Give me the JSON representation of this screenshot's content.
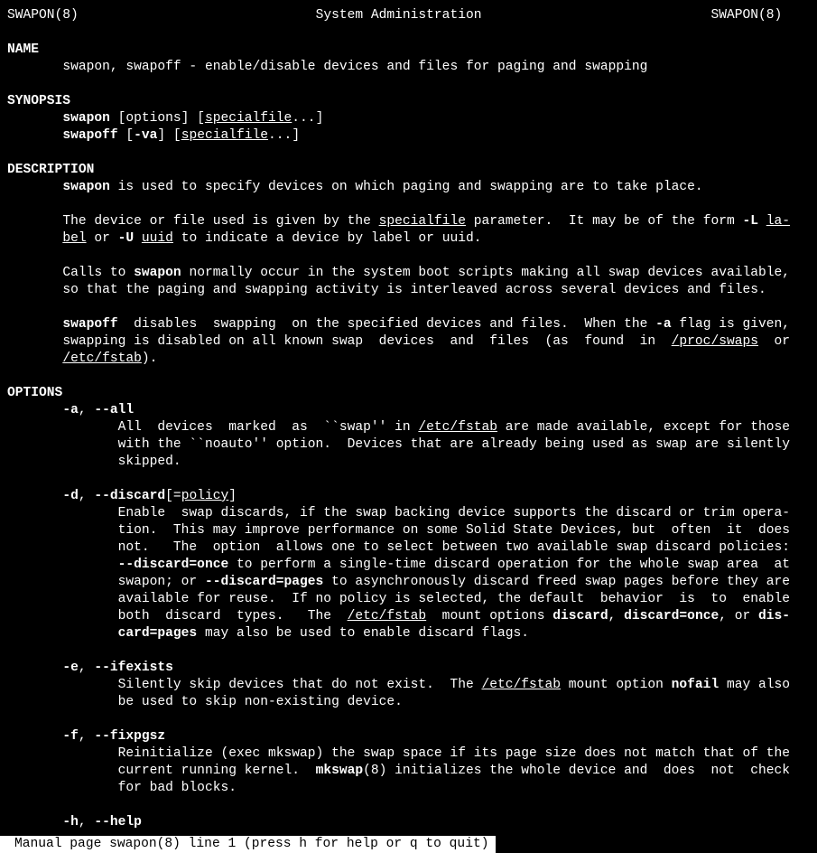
{
  "header": {
    "left": "SWAPON(8)",
    "center": "System Administration",
    "right": "SWAPON(8)"
  },
  "s_name": "NAME",
  "name_line": "swapon, swapoff - enable/disable devices and files for paging and swapping",
  "s_synopsis": "SYNOPSIS",
  "syn": {
    "swapon": "swapon",
    "swapon_tail": " [options] [",
    "specialfile": "specialfile",
    "ellip": "...]",
    "swapoff": "swapoff",
    "swapoff_mid": " [",
    "va": "-va",
    "swapoff_mid2": "] [",
    "swapoff_tail": "...]"
  },
  "s_desc": "DESCRIPTION",
  "d1a": "swapon",
  "d1b": " is used to specify devices on which paging and swapping are to take place.",
  "d2a": "The device or file used is given by the ",
  "d2b": "specialfile",
  "d2c": " parameter.  It may be of the form ",
  "d2d": "-L",
  "d2e": " ",
  "d2f": "la-",
  "d3a": "bel",
  "d3b": " or ",
  "d3c": "-U",
  "d3d": " ",
  "d3e": "uuid",
  "d3f": " to indicate a device by label or uuid.",
  "d4a": "Calls to ",
  "d4b": "swapon",
  "d4c": " normally occur in the system boot scripts making all swap devices available,",
  "d5": "so that the paging and swapping activity is interleaved across several devices and files.",
  "d6a": "swapoff",
  "d6b": "  disables  swapping  on the specified devices and files.  When the ",
  "d6c": "-a",
  "d6d": " flag is given,",
  "d7a": "swapping is disabled on all known swap  devices  and  files  (as  found  in  ",
  "d7b": "/proc/swaps",
  "d7c": "  or",
  "d8a": "/etc/fstab",
  "d8b": ").",
  "s_options": "OPTIONS",
  "oa1": "-a",
  "oa2": ", ",
  "oa3": "--all",
  "oa_t1a": "All  devices  marked  as  ``swap'' in ",
  "oa_t1b": "/etc/fstab",
  "oa_t1c": " are made available, except for those",
  "oa_t2": "with the ``noauto'' option.  Devices that are already being used as swap are silently",
  "oa_t3": "skipped.",
  "od1": "-d",
  "od2": ", ",
  "od3": "--discard",
  "od4": "[=",
  "od5": "policy",
  "od6": "]",
  "od_t1": "Enable  swap discards, if the swap backing device supports the discard or trim opera-",
  "od_t2": "tion.  This may improve performance on some Solid State Devices, but  often  it  does",
  "od_t3": "not.   The  option  allows one to select between two available swap discard policies:",
  "od_t4a": "--discard=once",
  "od_t4b": " to perform a single-time discard operation for the whole swap area  at",
  "od_t5a": "swapon; or ",
  "od_t5b": "--discard=pages",
  "od_t5c": " to asynchronously discard freed swap pages before they are",
  "od_t6": "available for reuse.  If no policy is selected, the default  behavior  is  to  enable",
  "od_t7a": "both  discard  types.   The  ",
  "od_t7b": "/etc/fstab",
  "od_t7c": "  mount options ",
  "od_t7d": "discard",
  "od_t7e": ", ",
  "od_t7f": "discard=once",
  "od_t7g": ", or ",
  "od_t7h": "dis-",
  "od_t8a": "card=pages",
  "od_t8b": " may also be used to enable discard flags.",
  "oe1": "-e",
  "oe2": ", ",
  "oe3": "--ifexists",
  "oe_t1a": "Silently skip devices that do not exist.  The ",
  "oe_t1b": "/etc/fstab",
  "oe_t1c": " mount option ",
  "oe_t1d": "nofail",
  "oe_t1e": " may also",
  "oe_t2": "be used to skip non-existing device.",
  "of1": "-f",
  "of2": ", ",
  "of3": "--fixpgsz",
  "of_t1": "Reinitialize (exec mkswap) the swap space if its page size does not match that of the",
  "of_t2a": "current running kernel.  ",
  "of_t2b": "mkswap",
  "of_t2c": "(8) initializes the whole device and  does  not  check",
  "of_t3": "for bad blocks.",
  "oh1": "-h",
  "oh2": ", ",
  "oh3": "--help",
  "status": "Manual page swapon(8) line 1 (press h for help or q to quit)"
}
